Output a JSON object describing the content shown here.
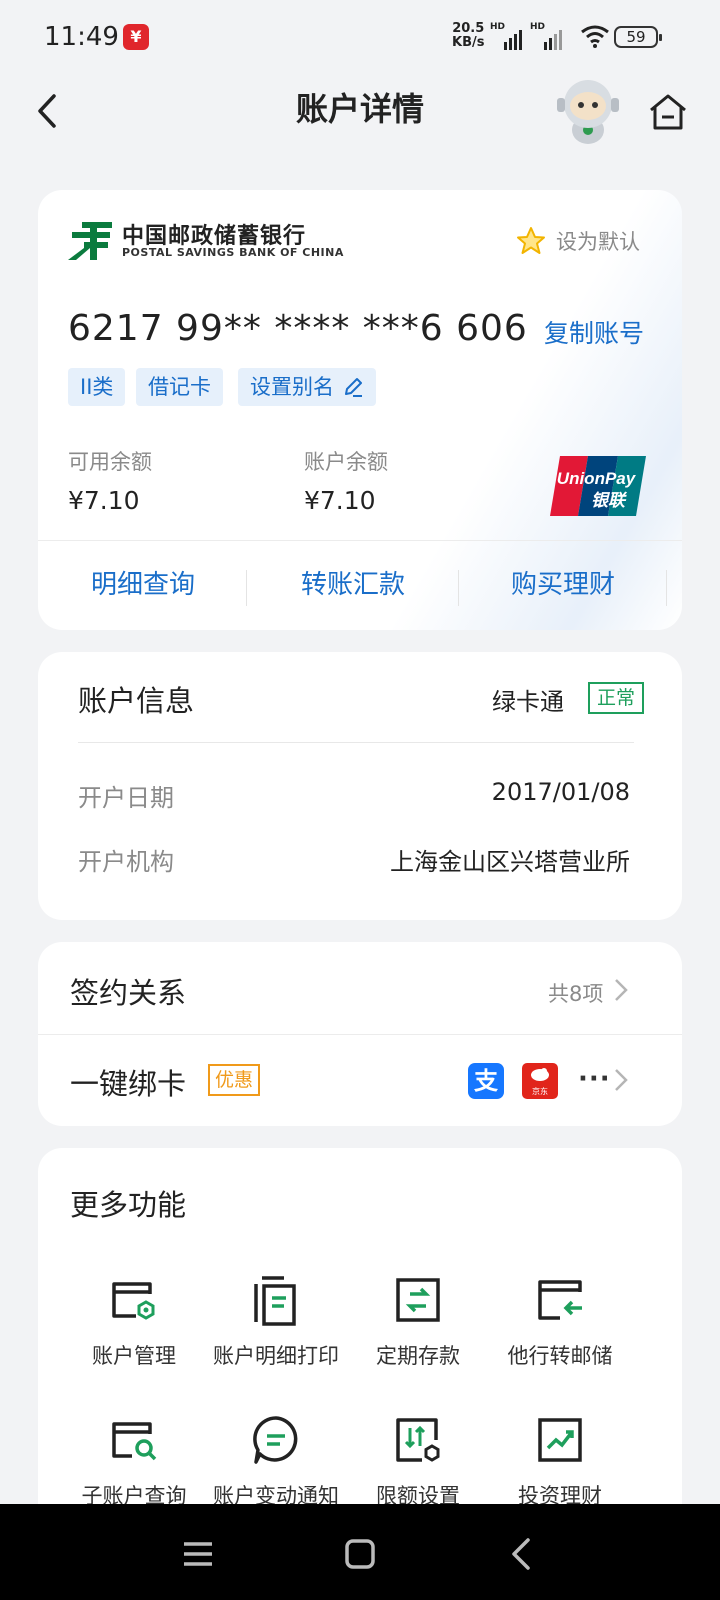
{
  "status_bar": {
    "time": "11:49",
    "net_speed_value": "20.5",
    "net_speed_unit": "KB/s",
    "sim1": "HD",
    "sim2": "HD",
    "battery": "59"
  },
  "header": {
    "title": "账户详情"
  },
  "account_card": {
    "bank_name_cn": "中国邮政储蓄银行",
    "bank_name_en": "POSTAL SAVINGS BANK OF CHINA",
    "set_default_label": "设为默认",
    "card_number": "6217 99** **** ***6 606",
    "copy_label": "复制账号",
    "tags": [
      "II类",
      "借记卡",
      "设置别名"
    ],
    "available_label": "可用余额",
    "available_value": "¥7.10",
    "balance_label": "账户余额",
    "balance_value": "¥7.10",
    "unionpay_line1": "UnionPay",
    "unionpay_line2": "银联",
    "actions": [
      "明细查询",
      "转账汇款",
      "购买理财"
    ]
  },
  "account_info": {
    "title": "账户信息",
    "card_type": "绿卡通",
    "status": "正常",
    "rows": [
      {
        "label": "开户日期",
        "value": "2017/01/08"
      },
      {
        "label": "开户机构",
        "value": "上海金山区兴塔营业所"
      }
    ]
  },
  "relations": {
    "sign_label": "签约关系",
    "sign_count": "共8项",
    "bind_label": "一键绑卡",
    "promo": "优惠",
    "alipay_glyph": "支",
    "jd_label": "京东",
    "more": "···"
  },
  "more_functions": {
    "title": "更多功能",
    "items": [
      {
        "label": "账户管理",
        "icon": "account-manage-icon"
      },
      {
        "label": "账户明细打印",
        "icon": "statement-print-icon"
      },
      {
        "label": "定期存款",
        "icon": "time-deposit-icon"
      },
      {
        "label": "他行转邮储",
        "icon": "transfer-in-icon"
      },
      {
        "label": "子账户查询",
        "icon": "sub-account-search-icon"
      },
      {
        "label": "账户变动通知",
        "icon": "change-notify-icon"
      },
      {
        "label": "限额设置",
        "icon": "limit-settings-icon"
      },
      {
        "label": "投资理财",
        "icon": "investment-icon"
      }
    ]
  },
  "colors": {
    "accent_blue": "#1a6ec9",
    "status_green": "#1e9f5c",
    "promo_orange": "#f09a1a",
    "bank_green": "#0b7b3e"
  }
}
